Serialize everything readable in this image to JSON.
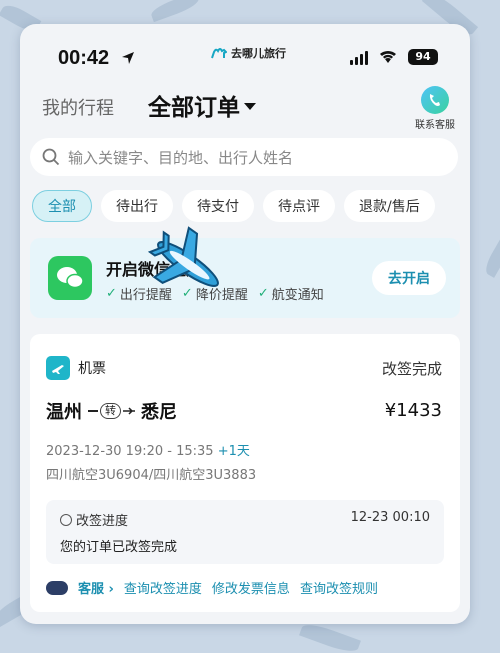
{
  "status_bar": {
    "time": "00:42",
    "app_name": "去哪儿旅行",
    "battery": "94"
  },
  "header": {
    "my_trip": "我的行程",
    "all_orders": "全部订单",
    "service_label": "联系客服"
  },
  "search": {
    "placeholder": "输入关键字、目的地、出行人姓名"
  },
  "tabs": [
    {
      "label": "全部",
      "active": true
    },
    {
      "label": "待出行"
    },
    {
      "label": "待支付"
    },
    {
      "label": "待点评"
    },
    {
      "label": "退款/售后"
    }
  ],
  "wechat": {
    "title": "开启微信通知",
    "features": [
      "出行提醒",
      "降价提醒",
      "航变通知"
    ],
    "button": "去开启"
  },
  "order": {
    "type": "机票",
    "status": "改签完成",
    "from": "温州",
    "transfer": "转",
    "to": "悉尼",
    "price": "¥1433",
    "datetime": "2023-12-30 19:20 - 15:35",
    "plus_day": "+1天",
    "airline": "四川航空3U6904/四川航空3U3883",
    "progress_title": "改签进度",
    "progress_time": "12-23 00:10",
    "progress_desc": "您的订单已改签完成",
    "actions": {
      "service": "客服",
      "query_progress": "查询改签进度",
      "modify_invoice": "修改发票信息",
      "query_rules": "查询改签规则"
    }
  },
  "colors": {
    "accent": "#1c8fb0",
    "wechat_green": "#2dc760",
    "ticket_icon": "#1fb5c9"
  }
}
